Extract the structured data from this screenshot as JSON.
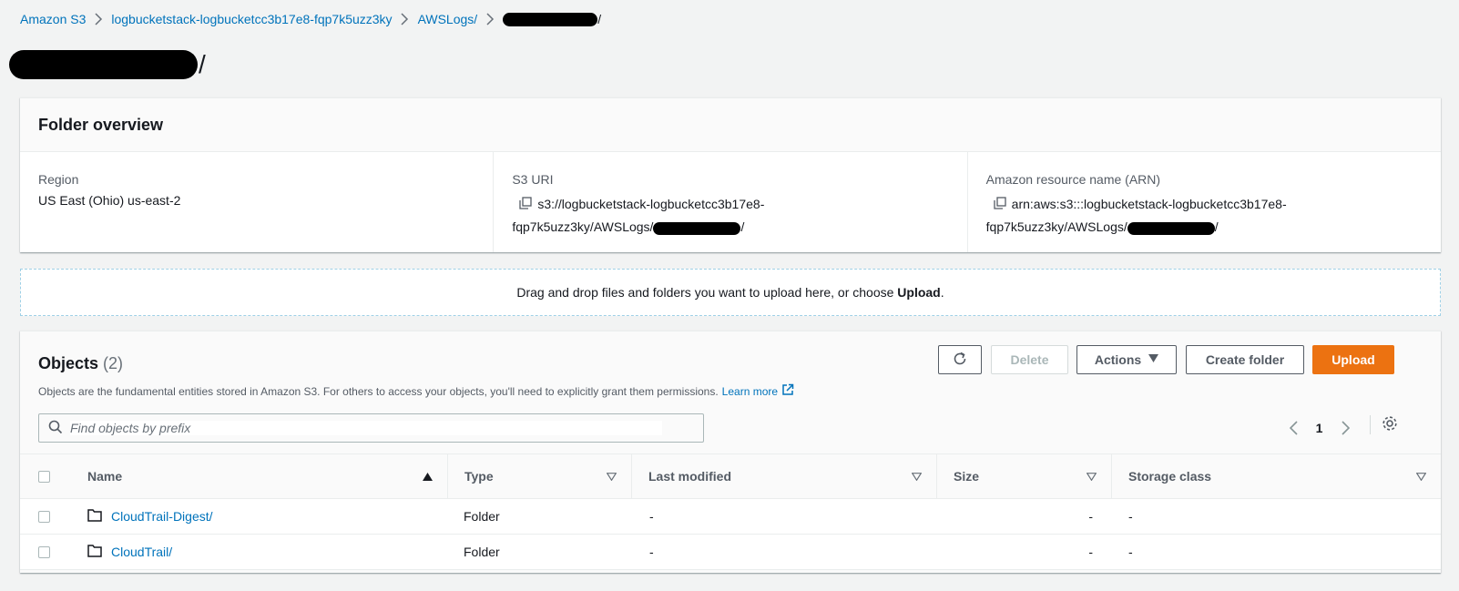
{
  "breadcrumb": {
    "items": [
      "Amazon S3",
      "logbucketstack-logbucketcc3b17e8-fqp7k5uzz3ky",
      "AWSLogs/"
    ],
    "last_suffix": "/"
  },
  "page": {
    "title_suffix": "/"
  },
  "overview": {
    "heading": "Folder overview",
    "region_label": "Region",
    "region_value": "US East (Ohio) us-east-2",
    "uri_label": "S3 URI",
    "uri_line1": "s3://logbucketstack-logbucketcc3b17e8-",
    "uri_line2": "fqp7k5uzz3ky/AWSLogs/",
    "uri_suffix": "/",
    "arn_label": "Amazon resource name (ARN)",
    "arn_line1": "arn:aws:s3:::logbucketstack-logbucketcc3b17e8-",
    "arn_line2": "fqp7k5uzz3ky/AWSLogs/",
    "arn_suffix": "/"
  },
  "dropzone": {
    "text": "Drag and drop files and folders you want to upload here, or choose ",
    "bold": "Upload",
    "end": "."
  },
  "objects": {
    "title": "Objects",
    "count": "(2)",
    "description": "Objects are the fundamental entities stored in Amazon S3. For others to access your objects, you'll need to explicitly grant them permissions.",
    "learn_more": "Learn more",
    "buttons": {
      "delete": "Delete",
      "actions": "Actions",
      "create_folder": "Create folder",
      "upload": "Upload"
    },
    "search_placeholder": "Find objects by prefix",
    "page_number": "1",
    "columns": {
      "name": "Name",
      "type": "Type",
      "last_modified": "Last modified",
      "size": "Size",
      "storage_class": "Storage class"
    },
    "rows": [
      {
        "name": "CloudTrail-Digest/",
        "type": "Folder",
        "last_modified": "-",
        "size": "-",
        "storage_class": "-"
      },
      {
        "name": "CloudTrail/",
        "type": "Folder",
        "last_modified": "-",
        "size": "-",
        "storage_class": "-"
      }
    ]
  },
  "colors": {
    "link": "#0073bb",
    "primary": "#ec7211",
    "background": "#f2f3f3"
  },
  "icons": [
    "chevron-right-icon",
    "copy-icon",
    "external-link-icon",
    "refresh-icon",
    "caret-down-icon",
    "search-icon",
    "chevron-left-icon",
    "gear-icon",
    "sort-asc-icon",
    "sort-icon",
    "folder-icon"
  ]
}
